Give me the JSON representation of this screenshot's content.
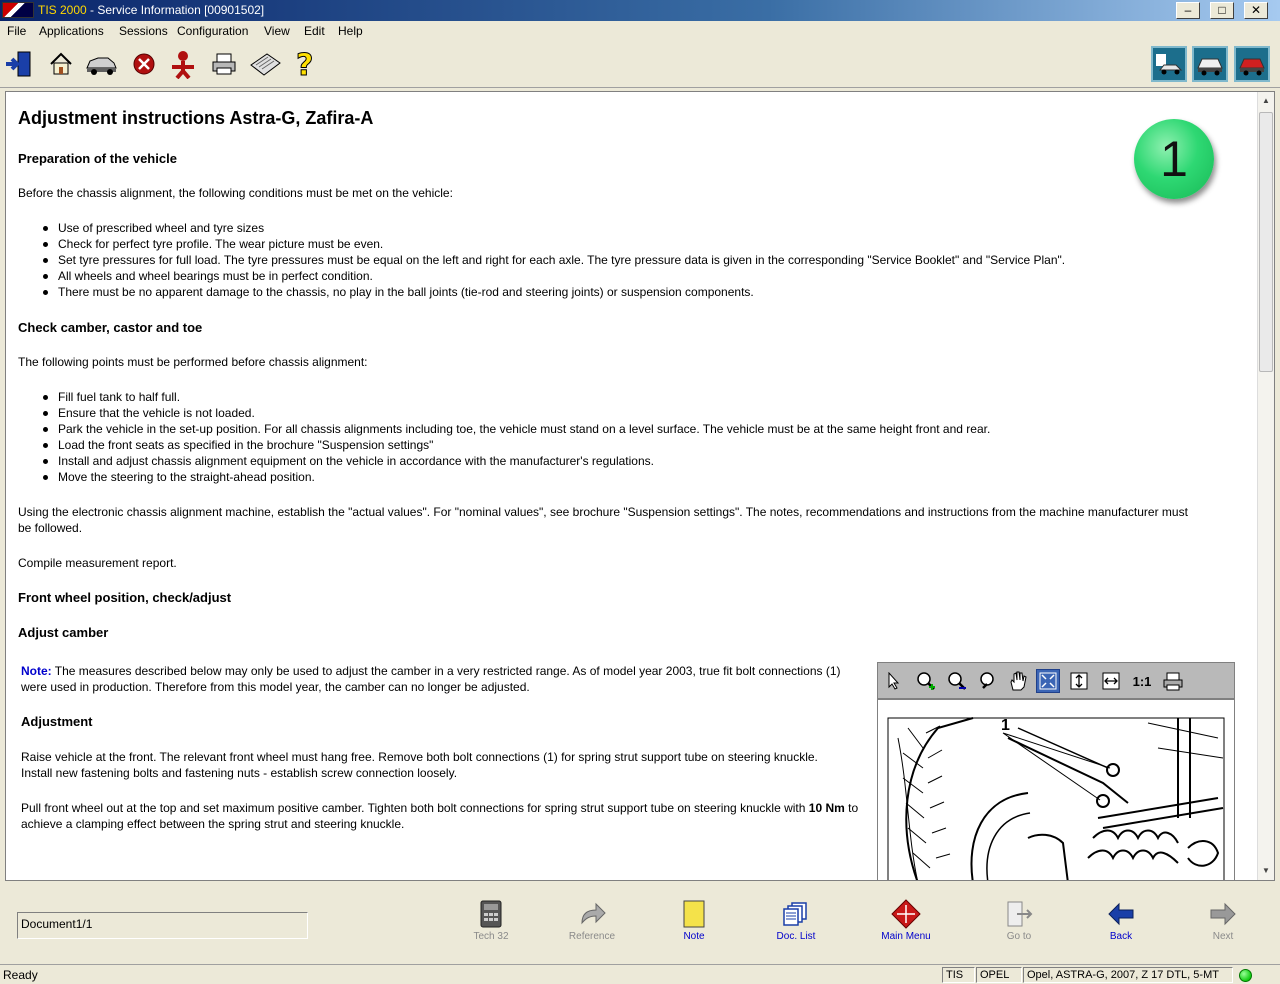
{
  "window": {
    "app_name": "TIS 2000",
    "title_rest": " - Service Information [00901502]",
    "minimize": "–",
    "maximize": "□",
    "close": "✕"
  },
  "menu": [
    "File",
    "Applications",
    "Sessions",
    "Configuration",
    "View",
    "Edit",
    "Help"
  ],
  "toolbar_icons": [
    "exit-icon",
    "home-icon",
    "vehicle-icon",
    "stop-icon",
    "person-icon",
    "print-icon",
    "keyboard-icon",
    "help-icon"
  ],
  "document": {
    "title": "Adjustment instructions Astra-G, Zafira-A",
    "badge": "1",
    "sec1_heading": "Preparation of the vehicle",
    "sec1_intro": "Before the chassis alignment, the following conditions must be met on the vehicle:",
    "sec1_items": [
      "Use of prescribed wheel and tyre sizes",
      "Check for perfect tyre profile. The wear picture must be even.",
      "Set tyre pressures for full load. The tyre pressures must be equal on the left and right for each axle. The tyre pressure data is given in the corresponding \"Service Booklet\" and \"Service Plan\".",
      "All wheels and wheel bearings must be in perfect condition.",
      "There must be no apparent damage to the chassis, no play in the ball joints (tie-rod and steering joints) or suspension components."
    ],
    "sec2_heading": "Check camber, castor and toe",
    "sec2_intro": "The following points must be performed before chassis alignment:",
    "sec2_items": [
      "Fill fuel tank to half full.",
      "Ensure that the vehicle is not loaded.",
      "Park the vehicle in the set-up position. For all chassis alignments including toe, the vehicle must stand on a level surface. The vehicle must be at the same height front and rear.",
      "Load the front seats as specified in the brochure \"Suspension settings\"",
      "Install and adjust chassis alignment equipment on the vehicle in accordance with the manufacturer's regulations.",
      "Move the steering to the straight-ahead position."
    ],
    "para_machine": "Using the electronic chassis alignment machine, establish the \"actual values\". For \"nominal values\", see brochure \"Suspension settings\". The notes, recommendations and instructions from the machine manufacturer must be followed.",
    "para_report": "Compile measurement report.",
    "sec3_heading": "Front wheel position, check/adjust",
    "sec4_heading": "Adjust camber",
    "note_label": "Note:",
    "note_text": " The measures described below may only be used to adjust the camber in a very restricted range. As of model year 2003, true fit bolt connections (1) were used in production. Therefore from this model year, the camber can no longer be adjusted.",
    "adj_heading": "Adjustment",
    "adj_para1": "Raise vehicle at the front. The relevant front wheel must hang free. Remove both bolt connections (1) for spring strut support tube on steering knuckle. Install new fastening bolts and fastening nuts - establish screw connection loosely.",
    "adj_para2_a": "Pull front wheel out at the top and set maximum positive camber. Tighten both bolt connections for spring strut support tube on steering knuckle with ",
    "adj_para2_bold": "10 Nm",
    "adj_para2_b": " to achieve a clamping effect between the spring strut and steering knuckle."
  },
  "viewer": {
    "one_to_one": "1:1",
    "callout": "1"
  },
  "bottom": {
    "doc_position": "Document1/1",
    "nav": [
      {
        "label": "Tech 32",
        "enabled": false,
        "icon": "tech32-icon"
      },
      {
        "label": "Reference",
        "enabled": false,
        "icon": "reference-icon"
      },
      {
        "label": "Note",
        "enabled": true,
        "icon": "note-icon"
      },
      {
        "label": "Doc. List",
        "enabled": true,
        "icon": "doc-list-icon"
      },
      {
        "label": "Main Menu",
        "enabled": true,
        "icon": "main-menu-icon"
      },
      {
        "label": "Go to",
        "enabled": false,
        "icon": "go-to-icon"
      },
      {
        "label": "Back",
        "enabled": true,
        "icon": "back-icon"
      },
      {
        "label": "Next",
        "enabled": false,
        "icon": "next-icon"
      }
    ]
  },
  "status": {
    "text": "Ready",
    "tis": "TIS",
    "make": "OPEL",
    "vehicle": "Opel, ASTRA-G, 2007, Z 17 DTL, 5-MT"
  }
}
